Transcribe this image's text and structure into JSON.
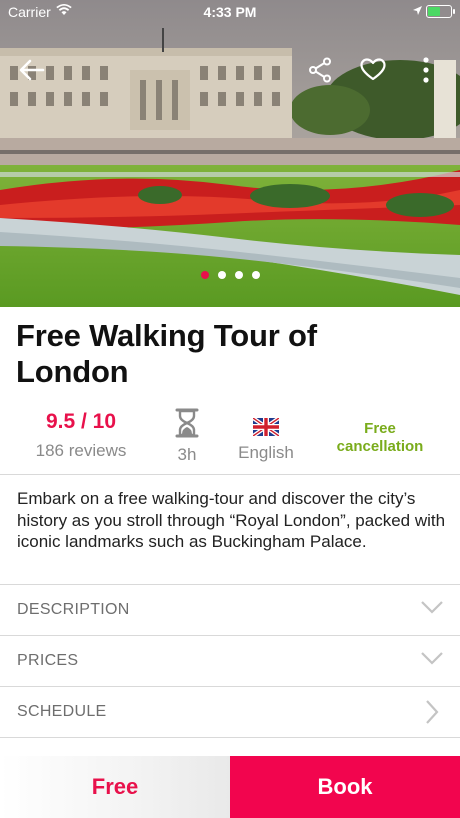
{
  "status_bar": {
    "carrier": "Carrier",
    "time": "4:33 PM"
  },
  "hero": {
    "icons": [
      "back-arrow-icon",
      "share-icon",
      "heart-icon",
      "more-vertical-icon"
    ],
    "carousel_total": 4,
    "carousel_active": 1
  },
  "tour": {
    "title": "Free Walking Tour of London"
  },
  "stats": {
    "score": "9.5 / 10",
    "reviews": "186 reviews",
    "duration": "3h",
    "language": "English",
    "cancellation": "Free cancellation"
  },
  "description": "Embark on a free walking-tour and discover the city’s history as you stroll through “Royal London”, packed with iconic landmarks such as Buckingham Palace.",
  "sections": [
    {
      "label": "DESCRIPTION"
    },
    {
      "label": "PRICES"
    },
    {
      "label": "SCHEDULE"
    }
  ],
  "footer": {
    "price": "Free",
    "book": "Book"
  },
  "colors": {
    "accent": "#e8114b",
    "book_bg": "#f2054e",
    "cancel_green": "#7aac1c"
  }
}
